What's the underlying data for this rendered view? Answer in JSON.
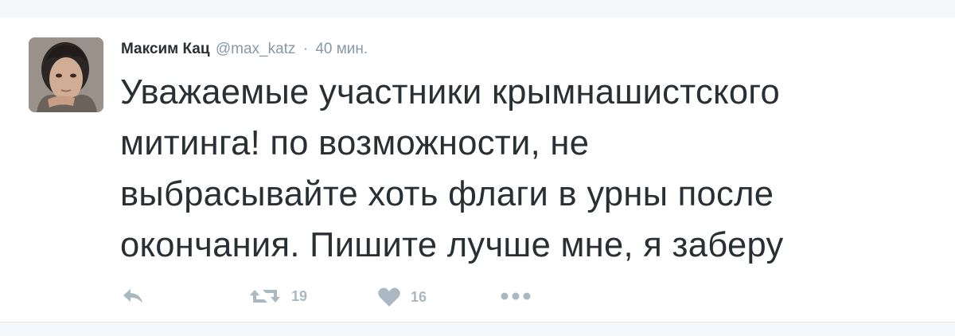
{
  "tweet": {
    "fullname": "Максим Кац",
    "username": "@max_katz",
    "separator": "·",
    "time": "40 мин.",
    "lines": [
      "Уважаемые участники крымнашистского",
      "митинга! по возможности, не",
      "выбрасывайте хоть флаги в урны после",
      "окончания. Пишите лучше мне, я заберу"
    ],
    "retweet_count": "19",
    "like_count": "16"
  },
  "colors": {
    "text": "#292f33",
    "muted": "#8899a6",
    "icon": "#aab8c2",
    "background": "#f5f8fa",
    "divider": "#e1e8ed"
  },
  "icons": {
    "reply": "reply-icon",
    "retweet": "retweet-icon",
    "like": "heart-icon",
    "more": "more-dots-icon"
  }
}
